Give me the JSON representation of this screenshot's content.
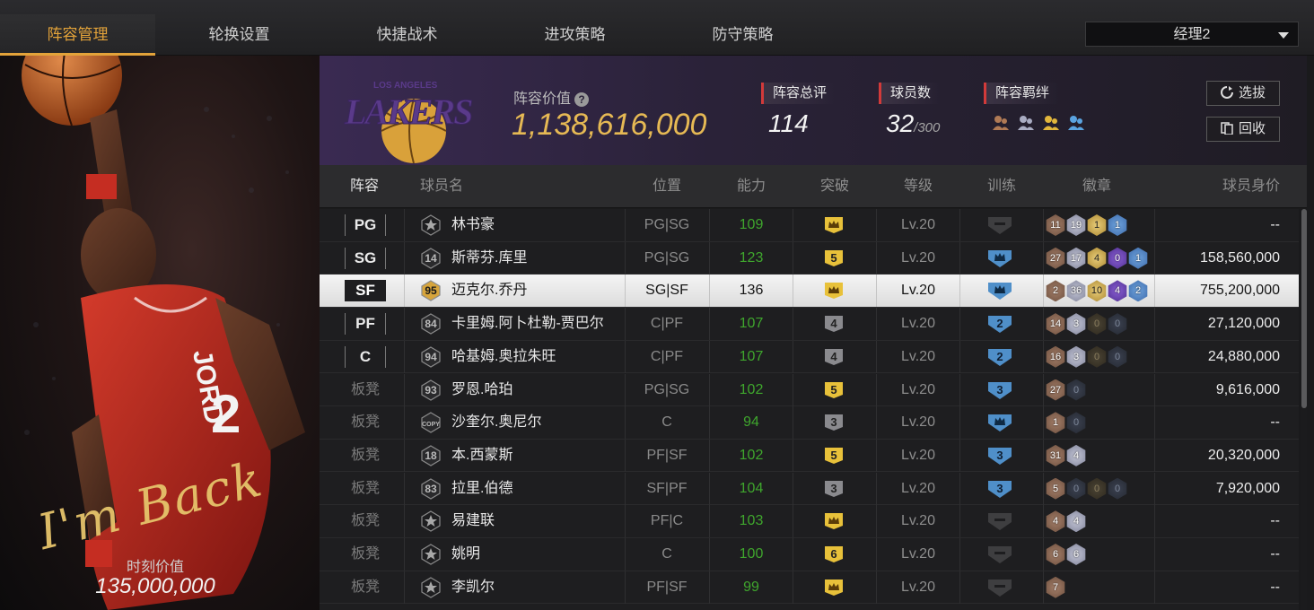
{
  "nav": {
    "tabs": [
      "阵容管理",
      "轮换设置",
      "快捷战术",
      "进攻策略",
      "防守策略"
    ],
    "active_tab": 0,
    "manager_select": "经理2"
  },
  "hero": {
    "signature": "I'm Back",
    "moment_label": "时刻价值",
    "moment_value": "135,000,000"
  },
  "team": {
    "logo_text": "LOS ANGELES LAKERS",
    "value_label": "阵容价值",
    "value": "1,138,616,000",
    "rating_label": "阵容总评",
    "rating": "114",
    "players_label": "球员数",
    "players": "32",
    "players_max": "/300",
    "bonds_label": "阵容羁绊",
    "bond_colors": [
      "#b07a55",
      "#a9acc2",
      "#e2b63c",
      "#5aa3e0"
    ],
    "draft_button": "选拔",
    "recycle_button": "回收"
  },
  "table": {
    "headers": [
      "阵容",
      "球员名",
      "位置",
      "能力",
      "突破",
      "等级",
      "训练",
      "徽章",
      "球员身价"
    ],
    "rows": [
      {
        "slot": "PG",
        "bench": false,
        "tier": "star",
        "name": "林书豪",
        "pos": "PG|SG",
        "ability": "109",
        "breakthrough": "crown",
        "level": "Lv.20",
        "training": "none",
        "badges": [
          [
            "bronze",
            "11"
          ],
          [
            "silver",
            "19"
          ],
          [
            "gold",
            "1"
          ],
          [
            "blue",
            "1"
          ]
        ],
        "value": "--"
      },
      {
        "slot": "SG",
        "bench": false,
        "tier": "14",
        "name": "斯蒂芬.库里",
        "pos": "PG|SG",
        "ability": "123",
        "breakthrough": "5",
        "level": "Lv.20",
        "training": "crown",
        "badges": [
          [
            "bronze",
            "27"
          ],
          [
            "silver",
            "17"
          ],
          [
            "gold",
            "4"
          ],
          [
            "purple",
            "0"
          ],
          [
            "blue",
            "1"
          ]
        ],
        "value": "158,560,000"
      },
      {
        "slot": "SF",
        "bench": false,
        "tier": "95",
        "name": "迈克尔.乔丹",
        "pos": "SG|SF",
        "ability": "136",
        "breakthrough": "crown",
        "level": "Lv.20",
        "training": "crown",
        "badges": [
          [
            "bronze",
            "2"
          ],
          [
            "silver",
            "36"
          ],
          [
            "gold",
            "10"
          ],
          [
            "purple",
            "4"
          ],
          [
            "blue",
            "2"
          ]
        ],
        "value": "755,200,000",
        "highlight": true
      },
      {
        "slot": "PF",
        "bench": false,
        "tier": "84",
        "name": "卡里姆.阿卜杜勒-贾巴尔",
        "pos": "C|PF",
        "ability": "107",
        "breakthrough": "4",
        "level": "Lv.20",
        "training": "2",
        "badges": [
          [
            "bronze",
            "14"
          ],
          [
            "silver",
            "3"
          ],
          [
            "dark",
            "0"
          ],
          [
            "darkb",
            "0"
          ]
        ],
        "value": "27,120,000"
      },
      {
        "slot": "C",
        "bench": false,
        "tier": "94",
        "name": "哈基姆.奥拉朱旺",
        "pos": "C|PF",
        "ability": "107",
        "breakthrough": "4",
        "level": "Lv.20",
        "training": "2",
        "badges": [
          [
            "bronze",
            "16"
          ],
          [
            "silver",
            "3"
          ],
          [
            "dark",
            "0"
          ],
          [
            "darkb",
            "0"
          ]
        ],
        "value": "24,880,000"
      },
      {
        "slot": "板凳",
        "bench": true,
        "tier": "93",
        "name": "罗恩.哈珀",
        "pos": "PG|SG",
        "ability": "102",
        "breakthrough": "5",
        "level": "Lv.20",
        "training": "3",
        "badges": [
          [
            "bronze",
            "27"
          ],
          [
            "darks",
            "0"
          ]
        ],
        "value": "9,616,000"
      },
      {
        "slot": "板凳",
        "bench": true,
        "tier": "COPY",
        "name": "沙奎尔.奥尼尔",
        "pos": "C",
        "ability": "94",
        "breakthrough": "3",
        "level": "Lv.20",
        "training": "crown",
        "badges": [
          [
            "bronze",
            "1"
          ],
          [
            "darks",
            "0"
          ]
        ],
        "value": "--"
      },
      {
        "slot": "板凳",
        "bench": true,
        "tier": "18",
        "name": "本.西蒙斯",
        "pos": "PF|SF",
        "ability": "102",
        "breakthrough": "5",
        "level": "Lv.20",
        "training": "3",
        "badges": [
          [
            "bronze",
            "31"
          ],
          [
            "silver",
            "4"
          ]
        ],
        "value": "20,320,000"
      },
      {
        "slot": "板凳",
        "bench": true,
        "tier": "83",
        "name": "拉里.伯德",
        "pos": "SF|PF",
        "ability": "104",
        "breakthrough": "3",
        "level": "Lv.20",
        "training": "3",
        "badges": [
          [
            "bronze",
            "5"
          ],
          [
            "darks",
            "0"
          ],
          [
            "dark",
            "0"
          ],
          [
            "darkb",
            "0"
          ]
        ],
        "value": "7,920,000"
      },
      {
        "slot": "板凳",
        "bench": true,
        "tier": "star",
        "name": "易建联",
        "pos": "PF|C",
        "ability": "103",
        "breakthrough": "crown",
        "level": "Lv.20",
        "training": "none",
        "badges": [
          [
            "bronze",
            "4"
          ],
          [
            "silver",
            "4"
          ]
        ],
        "value": "--"
      },
      {
        "slot": "板凳",
        "bench": true,
        "tier": "star",
        "name": "姚明",
        "pos": "C",
        "ability": "100",
        "breakthrough": "6",
        "level": "Lv.20",
        "training": "none",
        "badges": [
          [
            "bronze",
            "6"
          ],
          [
            "silver",
            "6"
          ]
        ],
        "value": "--"
      },
      {
        "slot": "板凳",
        "bench": true,
        "tier": "star",
        "name": "李凯尔",
        "pos": "PF|SF",
        "ability": "99",
        "breakthrough": "crown",
        "level": "Lv.20",
        "training": "none",
        "badges": [
          [
            "bronze",
            "7"
          ]
        ],
        "value": "--"
      }
    ]
  },
  "colors": {
    "accent": "#e3a33a",
    "ability_green": "#3fa62d",
    "breakthrough_gold": "#e8c13a",
    "breakthrough_gray": "#8a8a8e",
    "training_blue": "#4f8fc9"
  }
}
